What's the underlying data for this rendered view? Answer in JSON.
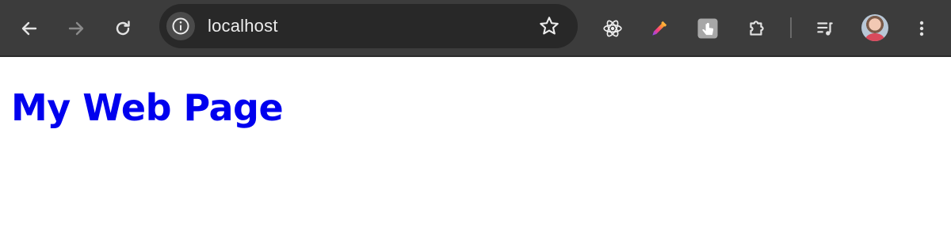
{
  "browser": {
    "address_bar": {
      "url": "localhost"
    },
    "icons": {
      "back": "arrow-left-icon",
      "forward": "arrow-right-icon",
      "reload": "reload-icon",
      "site_info": "info-icon",
      "bookmark": "star-icon",
      "react_devtools": "react-atom-icon",
      "color_picker": "eyedropper-icon",
      "extension_app": "hand-pointer-icon",
      "extensions": "puzzle-icon",
      "media_controls": "playlist-music-icon",
      "profile": "avatar",
      "menu": "kebab-menu-icon"
    },
    "colors": {
      "toolbar_bg": "#3c3c3c",
      "omnibox_bg": "#282828",
      "icon": "#e3e3e3",
      "icon_disabled": "#8a8a8a"
    }
  },
  "page": {
    "title": "My Web Page",
    "title_color": "#0000ee",
    "background": "#ffffff"
  }
}
